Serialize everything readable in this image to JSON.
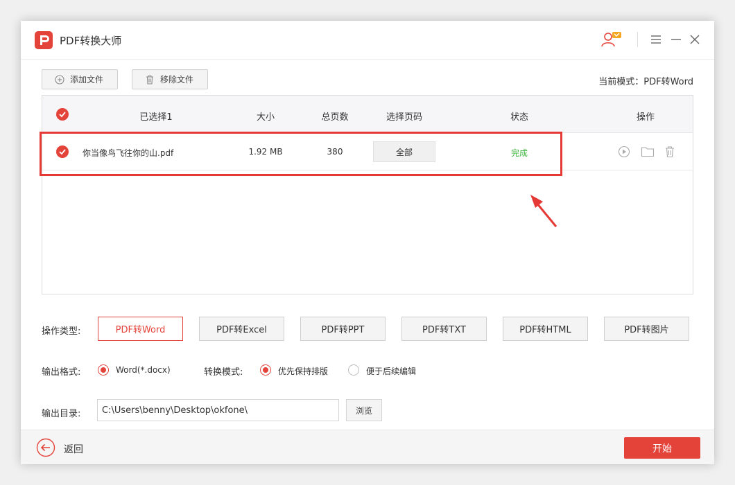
{
  "app": {
    "title": "PDF转换大师",
    "brand_color": "#e4433a",
    "logo_icon": "pdf-logo-icon"
  },
  "titlebar": {
    "icons": [
      "user-badge-icon",
      "menu-icon",
      "minimize-icon",
      "close-icon"
    ]
  },
  "toolbar": {
    "add_label": "添加文件",
    "remove_label": "移除文件",
    "mode_text": "当前模式：PDF转Word"
  },
  "table": {
    "headers": {
      "selected": "已选择1",
      "size": "大小",
      "pages": "总页数",
      "page_select": "选择页码",
      "status": "状态",
      "actions": "操作"
    },
    "rows": [
      {
        "name": "你当像鸟飞往你的山.pdf",
        "size": "1.92 MB",
        "pages": "380",
        "page_range": "全部",
        "status": "完成",
        "status_color": "#3cb33c",
        "action_icons": [
          "play-icon",
          "folder-icon",
          "trash-icon"
        ]
      }
    ]
  },
  "options": {
    "type_label": "操作类型:",
    "types": [
      "PDF转Word",
      "PDF转Excel",
      "PDF转PPT",
      "PDF转TXT",
      "PDF转HTML",
      "PDF转图片"
    ],
    "active_type": "PDF转Word",
    "format_label": "输出格式:",
    "format_option": "Word(*.docx)",
    "mode_label": "转换模式:",
    "mode_option1": "优先保持排版",
    "mode_option2": "便于后续编辑",
    "mode_selected": "优先保持排版",
    "dir_label": "输出目录:",
    "dir_value": "C:\\Users\\benny\\Desktop\\okfone\\",
    "browse_label": "浏览"
  },
  "footer": {
    "back_label": "返回",
    "start_label": "开始"
  },
  "annotation": {
    "highlight_color": "#e53935"
  }
}
